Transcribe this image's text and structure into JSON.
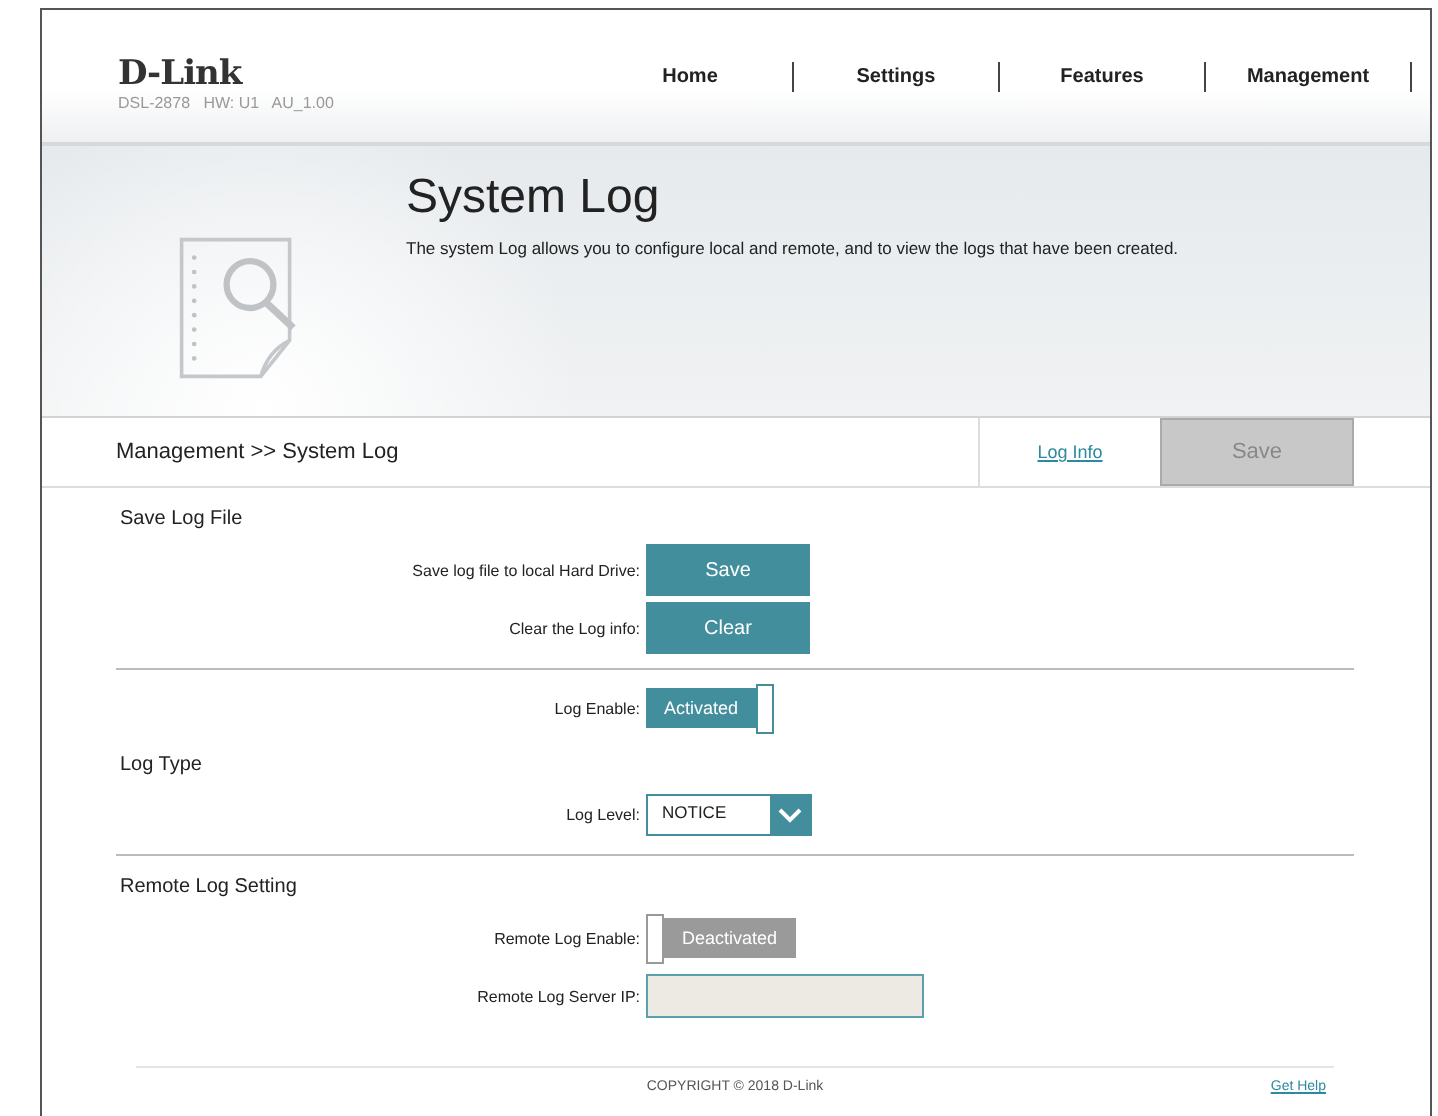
{
  "header": {
    "logo": "D-Link",
    "model": "DSL-2878   HW: U1   AU_1.00",
    "nav": [
      {
        "label": "Home"
      },
      {
        "label": "Settings"
      },
      {
        "label": "Features"
      },
      {
        "label": "Management"
      }
    ]
  },
  "banner": {
    "title": "System Log",
    "description": "The system Log allows you to configure local and remote, and to view the logs that have been created."
  },
  "toolbar": {
    "breadcrumb": "Management >> System Log",
    "link": "Log Info",
    "save": {
      "label": "Save",
      "disabled": true
    }
  },
  "groups": [
    {
      "items": [
        {
          "kind": "heading",
          "text": "Save Log File"
        },
        {
          "kind": "button",
          "label": "Save log file to local Hard Drive:",
          "button": "Save"
        },
        {
          "kind": "button",
          "label": "Clear the Log info:",
          "button": "Clear"
        }
      ]
    },
    {
      "items": [
        {
          "kind": "toggle",
          "label": "Log Enable:",
          "on": true,
          "state_label": "Activated"
        },
        {
          "kind": "heading",
          "text": "Log Type"
        },
        {
          "kind": "select",
          "label": "Log Level:",
          "value": "NOTICE"
        }
      ]
    },
    {
      "items": [
        {
          "kind": "heading",
          "text": "Remote Log Setting"
        },
        {
          "kind": "toggle",
          "label": "Remote Log Enable:",
          "on": false,
          "state_label": "Deactivated"
        },
        {
          "kind": "input",
          "label": "Remote Log Server IP:"
        }
      ]
    }
  ],
  "footer": {
    "copyright": "COPYRIGHT © 2018 D-Link",
    "help": "Get Help"
  }
}
